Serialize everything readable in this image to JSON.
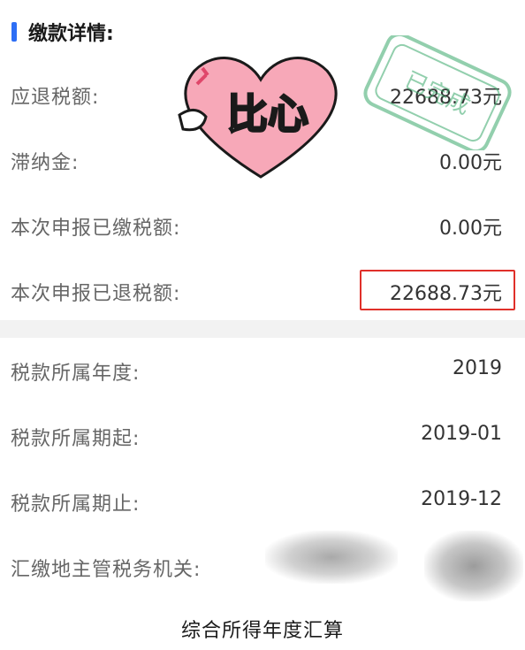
{
  "header": {
    "title": "缴款详情:"
  },
  "payment_details": [
    {
      "label": "应退税额:",
      "value": "22688.73元"
    },
    {
      "label": "滞纳金:",
      "value": "0.00元"
    },
    {
      "label": "本次申报已缴税额:",
      "value": "0.00元"
    },
    {
      "label": "本次申报已退税额:",
      "value": "22688.73元"
    }
  ],
  "tax_period": [
    {
      "label": "税款所属年度:",
      "value": "2019"
    },
    {
      "label": "税款所属期起:",
      "value": "2019-01"
    },
    {
      "label": "税款所属期止:",
      "value": "2019-12"
    },
    {
      "label": "汇缴地主管税务机关:",
      "value": ""
    }
  ],
  "stamp_text": "已完成",
  "sticker_text": "比心",
  "footer_title": "综合所得年度汇算",
  "colors": {
    "accent": "#2d6ef5",
    "highlight_border": "#e0302a",
    "stamp": "#3aa86b",
    "sticker_heart": "#f7a8b8"
  }
}
